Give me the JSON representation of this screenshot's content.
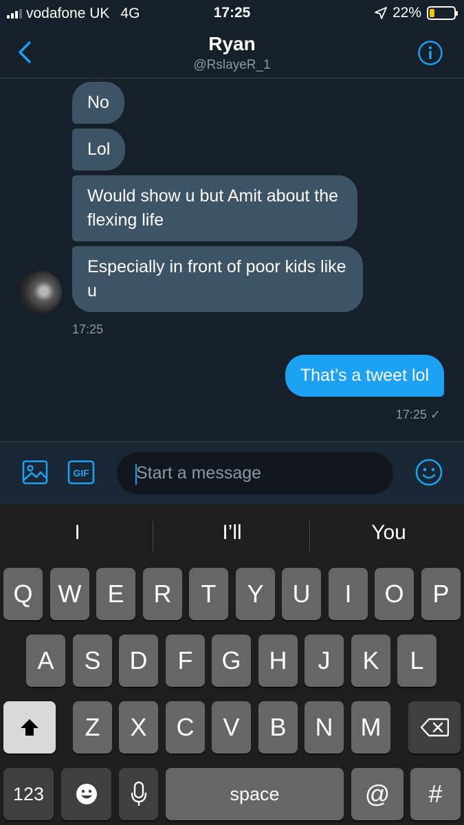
{
  "status_bar": {
    "carrier": "vodafone UK",
    "network": "4G",
    "time": "17:25",
    "battery": "22%",
    "battery_level": 0.22
  },
  "header": {
    "name": "Ryan",
    "handle": "@RslayeR_1"
  },
  "messages": [
    {
      "text": "No"
    },
    {
      "text": "Lol"
    },
    {
      "text": "Would show u but Amit about the flexing life"
    },
    {
      "text": "Especially in front of poor kids like u"
    },
    {
      "text": "That’s a tweet lol"
    }
  ],
  "timestamps": {
    "received": "17:25",
    "sent": "17:25 ✓"
  },
  "composer": {
    "placeholder": "Start a message",
    "gif_label": "GIF"
  },
  "keyboard": {
    "suggestions": [
      "I",
      "I’ll",
      "You"
    ],
    "row1": [
      "Q",
      "W",
      "E",
      "R",
      "T",
      "Y",
      "U",
      "I",
      "O",
      "P"
    ],
    "row2": [
      "A",
      "S",
      "D",
      "F",
      "G",
      "H",
      "J",
      "K",
      "L"
    ],
    "row3": [
      "Z",
      "X",
      "C",
      "V",
      "B",
      "N",
      "M"
    ],
    "numbers_label": "123",
    "space_label": "space",
    "at_label": "@",
    "hash_label": "#"
  },
  "colors": {
    "background": "#15202b",
    "accent": "#1da1f2",
    "incoming_bubble": "#3d5466",
    "battery": "#f7c500"
  }
}
